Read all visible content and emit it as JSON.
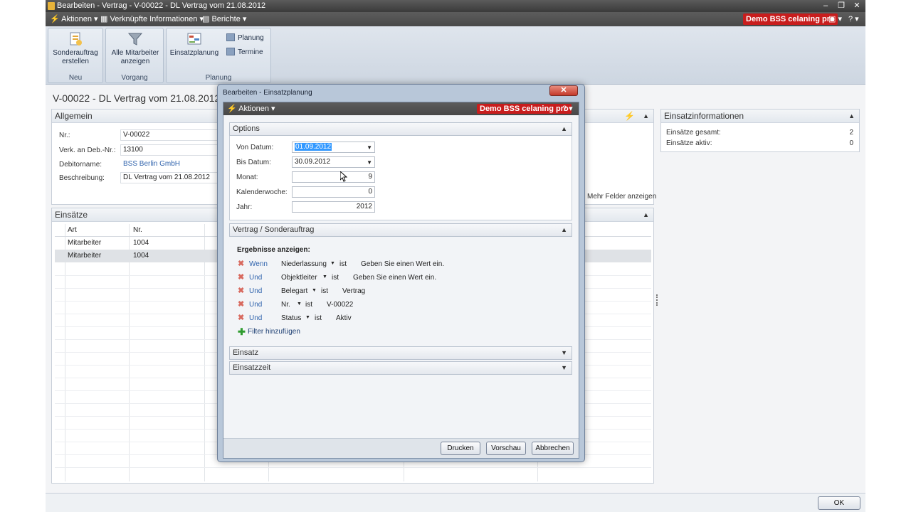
{
  "window": {
    "title": "Bearbeiten - Vertrag - V-00022 - DL Vertrag vom 21.08.2012",
    "minimize": "–",
    "restore": "❐",
    "close": "✕"
  },
  "menubar": {
    "aktionen": "Aktionen",
    "verknuepfte": "Verknüpfte Informationen",
    "berichte": "Berichte",
    "demo": "Demo BSS celaning pro",
    "help": "?"
  },
  "ribbon": {
    "groups": [
      {
        "label": "Neu",
        "buttons": [
          {
            "label": "Sonderauftrag erstellen",
            "icon": "document-new-icon"
          }
        ]
      },
      {
        "label": "Vorgang",
        "buttons": [
          {
            "label": "Alle Mitarbeiter anzeigen",
            "icon": "funnel-icon"
          }
        ]
      },
      {
        "label": "Planung",
        "buttons": [
          {
            "label": "Einsatzplanung",
            "icon": "planning-icon"
          }
        ],
        "small": [
          {
            "label": "Planung"
          },
          {
            "label": "Termine"
          }
        ]
      }
    ]
  },
  "page": {
    "title": "V-00022 - DL Vertrag vom 21.08.2012"
  },
  "allgemein": {
    "header": "Allgemein",
    "fields": [
      {
        "label": "Nr.:",
        "value": "V-00022"
      },
      {
        "label": "Verk. an Deb.-Nr.:",
        "value": "13100"
      },
      {
        "label": "Debitorname:",
        "value": "BSS Berlin GmbH"
      },
      {
        "label": "Beschreibung:",
        "value": "DL Vertrag vom 21.08.2012"
      }
    ],
    "mehr": "Mehr Felder anzeigen"
  },
  "einsaetze": {
    "header": "Einsätze",
    "columns": [
      "Art",
      "Nr."
    ],
    "rows": [
      {
        "art": "Mitarbeiter",
        "nr": "1004"
      },
      {
        "art": "Mitarbeiter",
        "nr": "1004"
      }
    ]
  },
  "einsatzinfo": {
    "header": "Einsatzinformationen",
    "rows": [
      {
        "label": "Einsätze gesamt:",
        "value": "2"
      },
      {
        "label": "Einsätze aktiv:",
        "value": "0"
      }
    ]
  },
  "dialog": {
    "title": "Bearbeiten - Einsatzplanung",
    "close": "✕",
    "menu": {
      "aktionen": "Aktionen",
      "demo": "Demo BSS celaning pro",
      "help": "?"
    },
    "options": {
      "header": "Options",
      "fields": [
        {
          "label": "Von Datum:",
          "value": "01.09.2012"
        },
        {
          "label": "Bis Datum:",
          "value": "30.09.2012"
        },
        {
          "label": "Monat:",
          "value": "9"
        },
        {
          "label": "Kalenderwoche:",
          "value": "0"
        },
        {
          "label": "Jahr:",
          "value": "2012"
        }
      ]
    },
    "vertrag": {
      "header": "Vertrag / Sonderauftrag",
      "ergebnisse": "Ergebnisse anzeigen:",
      "filters": [
        {
          "conj": "Wenn",
          "field": "Niederlassung",
          "op": "ist",
          "value": "Geben Sie einen Wert ein."
        },
        {
          "conj": "Und",
          "field": "Objektleiter",
          "op": "ist",
          "value": "Geben Sie einen Wert ein."
        },
        {
          "conj": "Und",
          "field": "Belegart",
          "op": "ist",
          "value": "Vertrag"
        },
        {
          "conj": "Und",
          "field": "Nr.",
          "op": "ist",
          "value": "V-00022"
        },
        {
          "conj": "Und",
          "field": "Status",
          "op": "ist",
          "value": "Aktiv"
        }
      ],
      "add_filter": "Filter hinzufügen"
    },
    "einsatz": {
      "header": "Einsatz"
    },
    "einsatzzeit": {
      "header": "Einsatzzeit"
    },
    "buttons": {
      "drucken": "Drucken",
      "vorschau": "Vorschau",
      "abbrechen": "Abbrechen"
    }
  },
  "statusbar": {
    "ok": "OK"
  }
}
